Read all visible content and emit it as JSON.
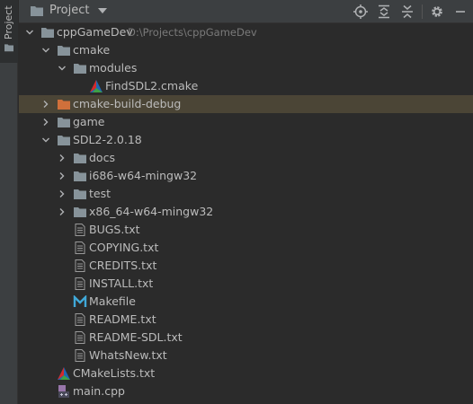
{
  "toolstrip": {
    "label": "Project"
  },
  "header": {
    "title": "Project"
  },
  "tree": {
    "root": {
      "label": "cppGameDev",
      "path": "D:\\Projects\\cppGameDev"
    },
    "cmake": "cmake",
    "modules": "modules",
    "findsdl2": "FindSDL2.cmake",
    "cmake_build_debug": "cmake-build-debug",
    "game": "game",
    "sdl": "SDL2-2.0.18",
    "docs": "docs",
    "i686": "i686-w64-mingw32",
    "test": "test",
    "x86": "x86_64-w64-mingw32",
    "bugs": "BUGS.txt",
    "copying": "COPYING.txt",
    "credits": "CREDITS.txt",
    "install": "INSTALL.txt",
    "makefile": "Makefile",
    "readme": "README.txt",
    "readme_sdl": "README-SDL.txt",
    "whatsnew": "WhatsNew.txt",
    "cmakelists": "CMakeLists.txt",
    "main": "main.cpp"
  },
  "colors": {
    "background": "#2b2b2b",
    "selection": "#4b4536",
    "folder": "#87939a",
    "excluded_folder": "#d0703b",
    "makefile_icon": "#40a8d8"
  }
}
